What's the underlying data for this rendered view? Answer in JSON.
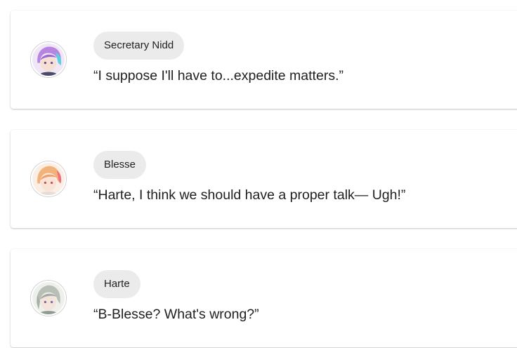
{
  "dialogue": [
    {
      "speaker": "Secretary Nidd",
      "text": "“I suppose I'll have to...expedite matters.”",
      "avatar_icon": "character-portrait-icon",
      "avatar_colors": {
        "hair": "#b784e0",
        "accent": "#5ad0e0",
        "skin": "#f6dfd3"
      }
    },
    {
      "speaker": "Blesse",
      "text": "“Harte, I think we should have a proper talk— Ugh!”",
      "avatar_icon": "character-portrait-icon",
      "avatar_colors": {
        "hair": "#f2b27a",
        "accent": "#f0707a",
        "skin": "#f9e2d6"
      }
    },
    {
      "speaker": "Harte",
      "text": "“B-Blesse? What's wrong?”",
      "avatar_icon": "character-portrait-icon",
      "avatar_colors": {
        "hair": "#b9bfb6",
        "accent": "#8f9a93",
        "skin": "#f4e4dc"
      }
    }
  ]
}
